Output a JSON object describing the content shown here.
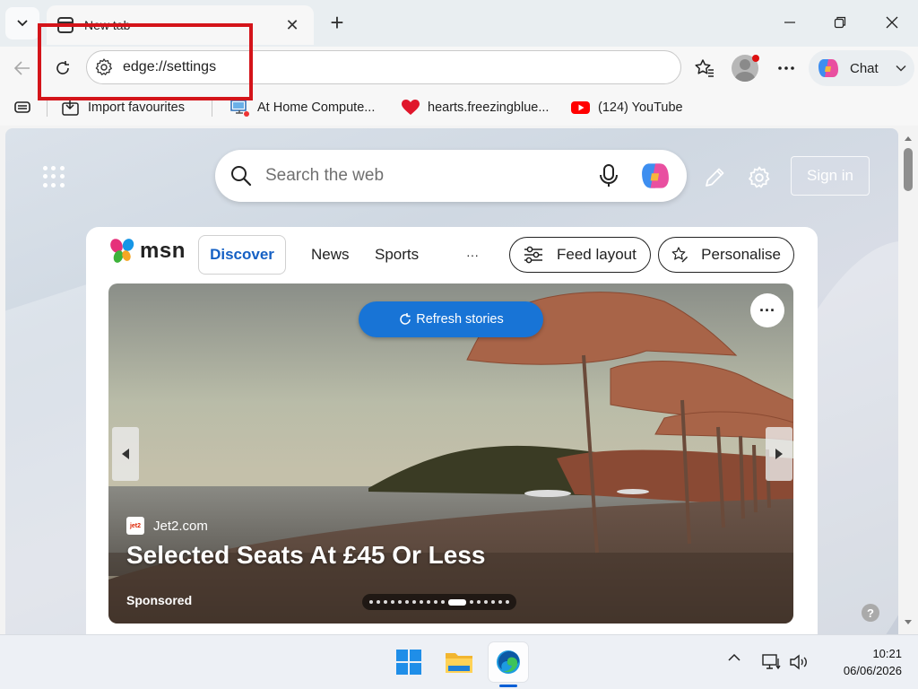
{
  "window": {
    "tab_title": "New tab",
    "colors": {
      "annotation": "#d4141a",
      "accent": "#1874d6",
      "msn_discover": "#1560c4"
    }
  },
  "toolbar": {
    "address": "edge://settings",
    "chat_label": "Chat"
  },
  "favourites": [
    {
      "label": "Import favourites",
      "icon": "import-favourites-icon"
    },
    {
      "label": "At Home Compute...",
      "icon": "computer-icon"
    },
    {
      "label": "hearts.freezingblue...",
      "icon": "heart-icon"
    },
    {
      "label": "(124) YouTube",
      "icon": "youtube-icon"
    }
  ],
  "newtab": {
    "search_placeholder": "Search the web",
    "sign_in": "Sign in"
  },
  "msn": {
    "logo": "msn",
    "nav": [
      "Discover",
      "News",
      "Sports",
      "···"
    ],
    "feed_layout": "Feed layout",
    "personalise": "Personalise",
    "hero": {
      "refresh": "Refresh stories",
      "more": "···",
      "source": "Jet2.com",
      "headline": "Selected Seats At £45 Or Less",
      "sponsored": "Sponsored",
      "carousel_count": 18,
      "carousel_active": 11
    },
    "help": "?"
  },
  "taskbar": {
    "apps": [
      "start-icon",
      "file-explorer-icon",
      "edge-icon"
    ],
    "time": "10:21",
    "date": "06/06/2026"
  }
}
